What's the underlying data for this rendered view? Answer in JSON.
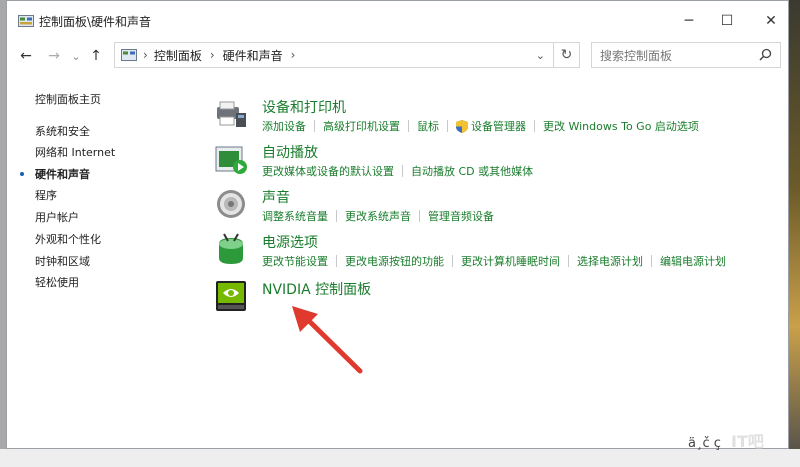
{
  "window": {
    "title": "控制面板\\硬件和声音",
    "minimize": "─",
    "maximize": "☐",
    "close": "✕"
  },
  "nav": {
    "back": "←",
    "forward": "→",
    "dropdown": "⌄",
    "up": "↑",
    "breadcrumb": [
      "控制面板",
      "硬件和声音"
    ],
    "breadcrumb_sep": "›",
    "refresh": "↻",
    "search_placeholder": "搜索控制面板"
  },
  "sidebar": {
    "items": [
      {
        "label": "控制面板主页"
      },
      {
        "label": "系统和安全"
      },
      {
        "label": "网络和 Internet"
      },
      {
        "label": "硬件和声音"
      },
      {
        "label": "程序"
      },
      {
        "label": "用户帐户"
      },
      {
        "label": "外观和个性化"
      },
      {
        "label": "时钟和区域"
      },
      {
        "label": "轻松使用"
      }
    ]
  },
  "categories": [
    {
      "title": "设备和打印机",
      "icon": "printer-icon",
      "links": [
        "添加设备",
        "高级打印机设置",
        "鼠标",
        "设备管理器",
        "更改 Windows To Go 启动选项"
      ]
    },
    {
      "title": "自动播放",
      "icon": "autoplay-icon",
      "links": [
        "更改媒体或设备的默认设置",
        "自动播放 CD 或其他媒体"
      ]
    },
    {
      "title": "声音",
      "icon": "speaker-icon",
      "links": [
        "调整系统音量",
        "更改系统声音",
        "管理音频设备"
      ]
    },
    {
      "title": "电源选项",
      "icon": "battery-icon",
      "links": [
        "更改节能设置",
        "更改电源按钮的功能",
        "更改计算机睡眠时间",
        "选择电源计划",
        "编辑电源计划"
      ]
    },
    {
      "title": "NVIDIA 控制面板",
      "icon": "nvidia-icon",
      "links": []
    }
  ],
  "watermark": {
    "text": "ä¸č ç",
    "logo": "IT吧"
  },
  "colors": {
    "link": "#1a7d2d",
    "arrow": "#e03a2f",
    "accent": "#1a5fb4"
  }
}
